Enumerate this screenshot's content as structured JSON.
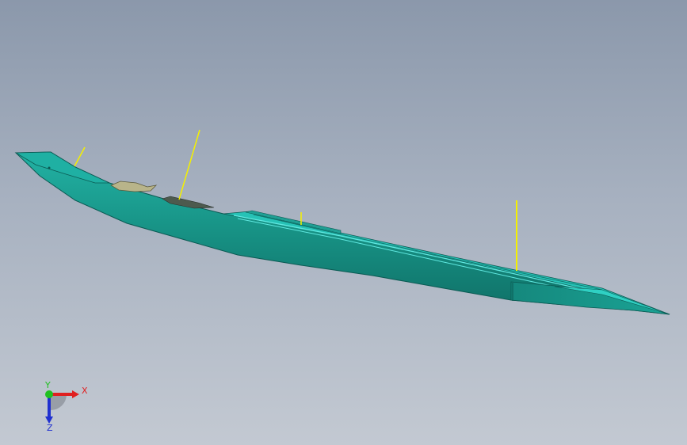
{
  "viewport": {
    "model": "ship-hull-model"
  },
  "triad": {
    "x_label": "X",
    "y_label": "Y",
    "z_label": "Z",
    "x_color": "#e02020",
    "y_color": "#20c020",
    "z_color": "#2030d0"
  },
  "colors": {
    "hull": "#1a9e92",
    "hull_dark": "#13776e",
    "deck_highlight": "#5fe8e0",
    "mast": "#f4f000",
    "structure": "#b8b48a"
  }
}
